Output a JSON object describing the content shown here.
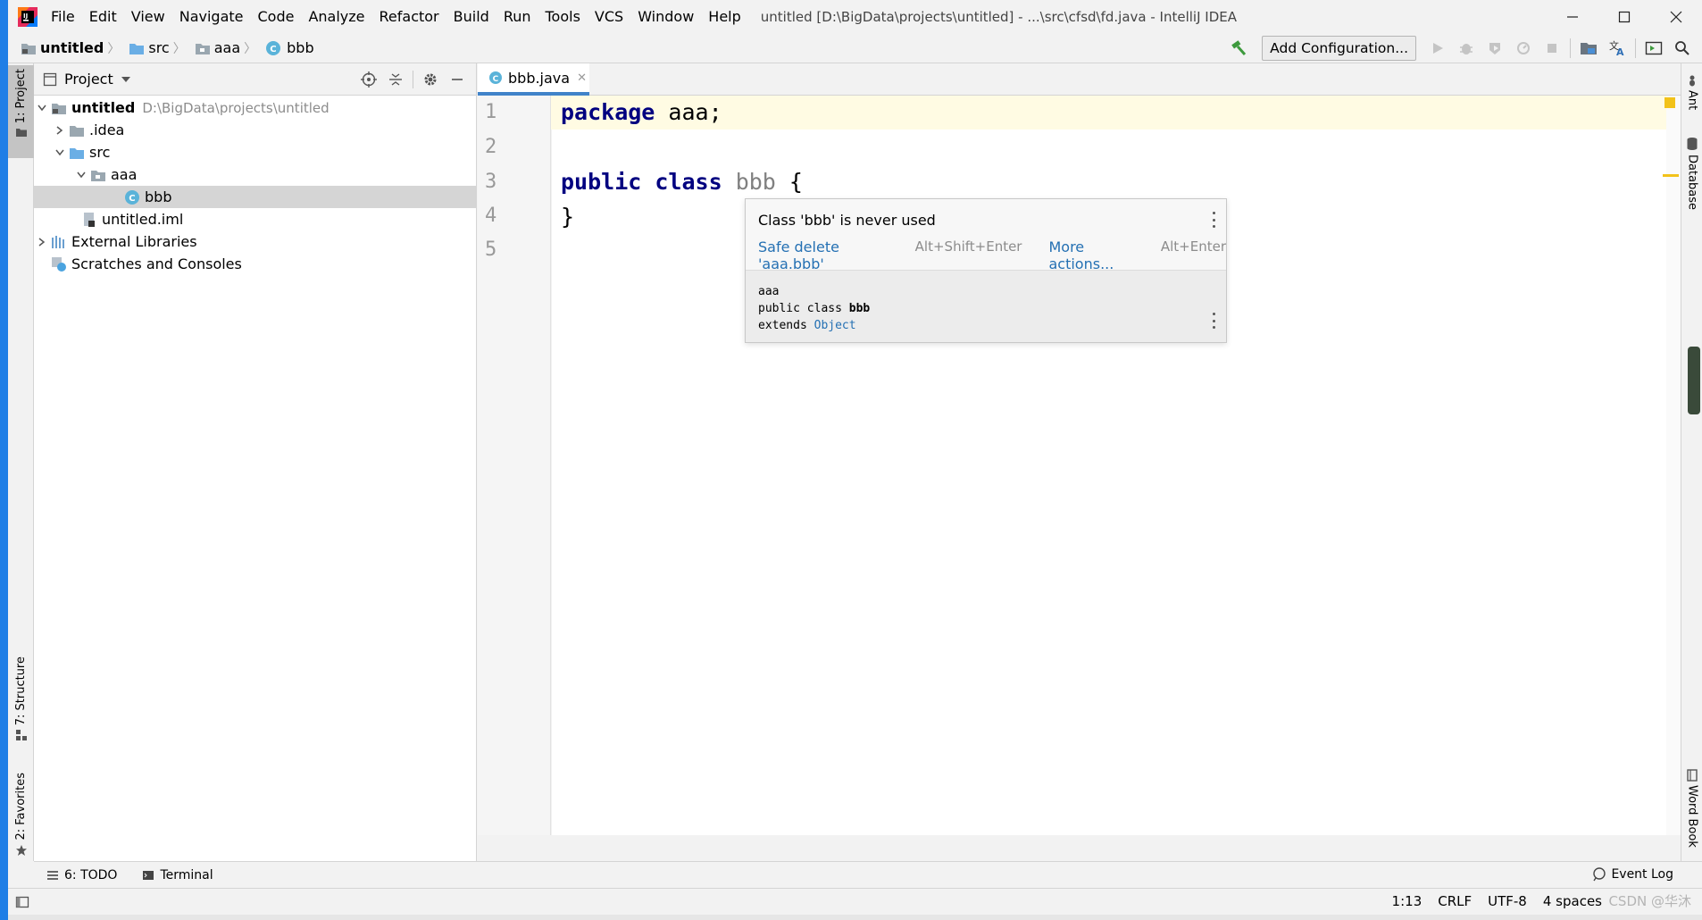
{
  "window": {
    "title": "untitled [D:\\BigData\\projects\\untitled] - ...\\src\\cfsd\\fd.java - IntelliJ IDEA"
  },
  "menu": {
    "items": [
      "File",
      "Edit",
      "View",
      "Navigate",
      "Code",
      "Analyze",
      "Refactor",
      "Build",
      "Run",
      "Tools",
      "VCS",
      "Window",
      "Help"
    ]
  },
  "breadcrumb": {
    "items": [
      "untitled",
      "src",
      "aaa",
      "bbb"
    ]
  },
  "toolbar": {
    "add_configuration": "Add Configuration..."
  },
  "left_strip": {
    "project": "1: Project",
    "structure": "7: Structure",
    "favorites": "2: Favorites"
  },
  "right_strip": {
    "ant": "Ant",
    "database": "Database",
    "word_book": "Word Book"
  },
  "project_panel": {
    "title": "Project",
    "tree": [
      {
        "label": "untitled",
        "path": "D:\\BigData\\projects\\untitled"
      },
      {
        "label": ".idea"
      },
      {
        "label": "src"
      },
      {
        "label": "aaa"
      },
      {
        "label": "bbb"
      },
      {
        "label": "untitled.iml"
      },
      {
        "label": "External Libraries"
      },
      {
        "label": "Scratches and Consoles"
      }
    ]
  },
  "editor": {
    "tab_label": "bbb.java",
    "line_numbers": [
      "1",
      "2",
      "3",
      "4",
      "5"
    ],
    "code": {
      "line1_kw": "package",
      "line1_rest": " aaa;",
      "line3_kw1": "public",
      "line3_kw2": "class",
      "line3_name": "bbb",
      "line3_rest": " {",
      "line4": "}"
    }
  },
  "popup": {
    "message": "Class 'bbb' is never used",
    "action1": "Safe delete 'aaa.bbb'",
    "action1_shortcut": "Alt+Shift+Enter",
    "action2": "More actions...",
    "action2_shortcut": "Alt+Enter",
    "doc_package": "aaa",
    "doc_decl_prefix": "public class ",
    "doc_decl_name": "bbb",
    "doc_extends": "extends ",
    "doc_super": "Object"
  },
  "bottom_tools": {
    "todo": "6: TODO",
    "terminal": "Terminal",
    "event_log": "Event Log"
  },
  "status": {
    "position": "1:13",
    "line_sep": "CRLF",
    "encoding": "UTF-8",
    "indent": "4 spaces"
  },
  "watermark": "CSDN @华沐",
  "colors": {
    "keyword": "#000080",
    "link": "#2470b3",
    "selection_tab": "#4083c9",
    "warning": "#f2c21a"
  }
}
